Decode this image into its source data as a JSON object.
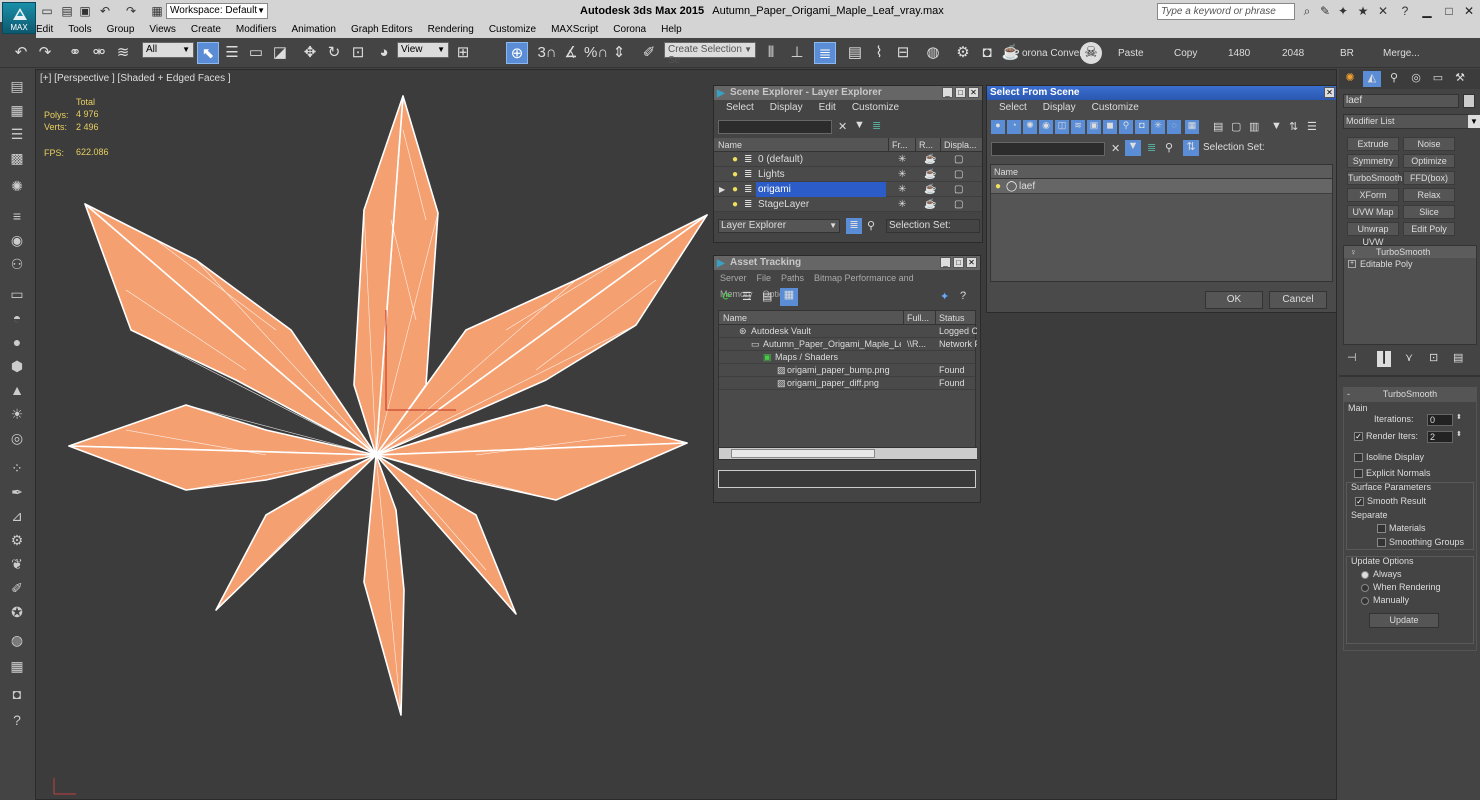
{
  "app": {
    "logo_text": "MAX",
    "workspace": "Workspace: Default",
    "title": "Autodesk 3ds Max  2015",
    "filename": "Autumn_Paper_Origami_Maple_Leaf_vray.max",
    "search_placeholder": "Type a keyword or phrase"
  },
  "menu": [
    "Edit",
    "Tools",
    "Group",
    "Views",
    "Create",
    "Modifiers",
    "Animation",
    "Graph Editors",
    "Rendering",
    "Customize",
    "MAXScript",
    "Corona",
    "Help"
  ],
  "toolbar": {
    "filter": "All",
    "view": "View",
    "snap_3": "3",
    "snap_pct": "%",
    "selection_set_placeholder": "Create Selection Se",
    "corona_convert": "orona Convert",
    "paste": "Paste",
    "copy": "Copy",
    "v1480": "1480",
    "v2048": "2048",
    "br": "BR",
    "merge": "Merge..."
  },
  "viewport": {
    "label": "[+] [Perspective ] [Shaded + Edged Faces ]",
    "stats": {
      "total_label": "Total",
      "polys_label": "Polys:",
      "polys": "4 976",
      "verts_label": "Verts:",
      "verts": "2 496",
      "fps_label": "FPS:",
      "fps": "622.086"
    },
    "leaf_color": "#f5a070"
  },
  "scene_explorer": {
    "title": "Scene Explorer - Layer Explorer",
    "menu": [
      "Select",
      "Display",
      "Edit",
      "Customize"
    ],
    "headers": [
      "Name",
      "Fr...",
      "R...",
      "Displa..."
    ],
    "rows": [
      "0 (default)",
      "Lights",
      "origami",
      "StageLayer"
    ],
    "selected": "origami",
    "footer_dropdown": "Layer Explorer",
    "selection_set": "Selection Set:"
  },
  "asset_tracking": {
    "title": "Asset Tracking",
    "menu": [
      "Server",
      "File",
      "Paths",
      "Bitmap Performance and Memory",
      "Options"
    ],
    "headers": [
      "Name",
      "Full...",
      "Status"
    ],
    "rows": [
      {
        "name": "Autodesk Vault",
        "full": "",
        "status": "Logged Ou"
      },
      {
        "name": "Autumn_Paper_Origami_Maple_Le...",
        "full": "\\\\R...",
        "status": "Network P"
      },
      {
        "name": "Maps / Shaders",
        "full": "",
        "status": ""
      },
      {
        "name": "origami_paper_bump.png",
        "full": "",
        "status": "Found"
      },
      {
        "name": "origami_paper_diff.png",
        "full": "",
        "status": "Found"
      }
    ]
  },
  "select_from_scene": {
    "title": "Select From Scene",
    "menu": [
      "Select",
      "Display",
      "Customize"
    ],
    "selection_set": "Selection Set:",
    "name_header": "Name",
    "item": "laef",
    "ok": "OK",
    "cancel": "Cancel"
  },
  "command_panel": {
    "object_name": "laef",
    "modifier_list": "Modifier List",
    "buttons": [
      "Extrude",
      "Noise",
      "Symmetry",
      "Optimize",
      "TurboSmooth",
      "FFD(box)",
      "XForm",
      "Relax",
      "UVW Map",
      "Slice",
      "Unwrap UVW",
      "Edit Poly"
    ],
    "stack": [
      "TurboSmooth",
      "Editable Poly"
    ],
    "rollout": {
      "title": "TurboSmooth",
      "main": "Main",
      "iterations_label": "Iterations:",
      "iterations": "0",
      "render_iters_label": "Render Iters:",
      "render_iters": "2",
      "isoline": "Isoline Display",
      "explicit": "Explicit Normals",
      "surface": "Surface Parameters",
      "smooth_result": "Smooth Result",
      "separate": "Separate",
      "materials": "Materials",
      "smoothing_groups": "Smoothing Groups",
      "update_options": "Update Options",
      "always": "Always",
      "when_rendering": "When Rendering",
      "manually": "Manually",
      "update": "Update"
    }
  }
}
